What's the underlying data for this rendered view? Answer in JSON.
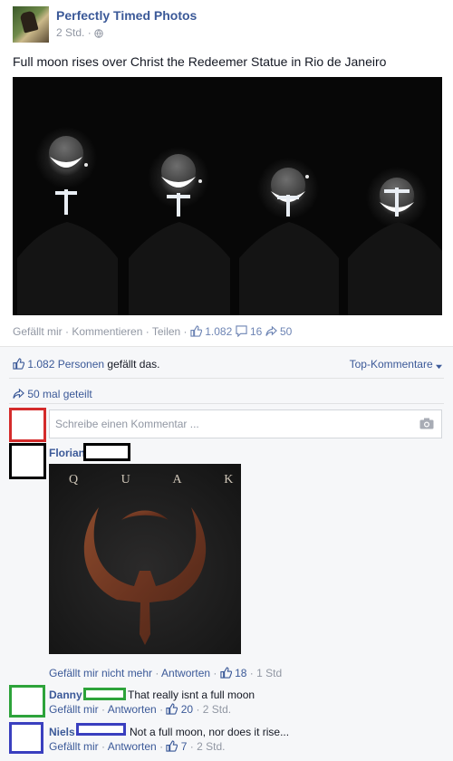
{
  "post": {
    "page_name": "Perfectly Timed Photos",
    "time": "2 Std. · ",
    "privacy_icon": "globe-icon",
    "caption": "Full moon rises over Christ the Redeemer Statue in Rio de Janeiro",
    "photo_alt": "",
    "actions": {
      "like": "Gefällt mir",
      "sep1": " · ",
      "comment": "Kommentieren",
      "sep2": " · ",
      "share": "Teilen",
      "sep3": " · ",
      "like_count": "1.082",
      "comment_count": "16",
      "share_count": "50"
    }
  },
  "ufi": {
    "likes_count_text": "1.082 Personen",
    "likes_suffix": " gefällt das.",
    "top_comments": "Top-Kommentare",
    "shares_text": "50 mal geteilt",
    "comment_placeholder": "Schreibe einen Kommentar ..."
  },
  "comments": [
    {
      "name": "Florian",
      "image_text": "Q U A K E",
      "action1": "Gefällt mir nicht mehr",
      "sep": " · ",
      "action2": "Antworten",
      "likes": "18",
      "time": "1 Std"
    },
    {
      "name": "Danny",
      "text": "That really isnt a full moon",
      "action1": "Gefällt mir",
      "sep": " · ",
      "action2": "Antworten",
      "likes": "20",
      "time": "2 Std."
    },
    {
      "name": "Niels",
      "text": "Not a full moon, nor does it rise...",
      "action1": "Gefällt mir",
      "sep": " · ",
      "action2": "Antworten",
      "likes": "7",
      "time": "2 Std."
    }
  ],
  "colors": {
    "link_blue": "#3b5998",
    "meta_grey": "#9197a3",
    "redact_red": "#d42b2b",
    "redact_black": "#000000",
    "redact_green": "#2da33a",
    "redact_blue": "#3a3fbf"
  }
}
